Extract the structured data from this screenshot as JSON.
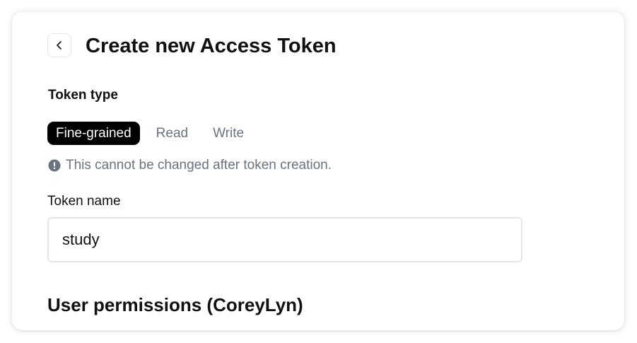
{
  "header": {
    "title": "Create new Access Token",
    "back_icon": "chevron-left-icon"
  },
  "token_type": {
    "label": "Token type",
    "options": [
      {
        "label": "Fine-grained",
        "selected": true
      },
      {
        "label": "Read",
        "selected": false
      },
      {
        "label": "Write",
        "selected": false
      }
    ],
    "note": "This cannot be changed after token creation.",
    "note_icon": "info-icon"
  },
  "token_name": {
    "label": "Token name",
    "value": "study"
  },
  "permissions": {
    "heading": "User permissions (CoreyLyn)"
  },
  "colors": {
    "accent": "#000000",
    "muted_text": "#6b7280",
    "border": "#e5e7eb"
  }
}
